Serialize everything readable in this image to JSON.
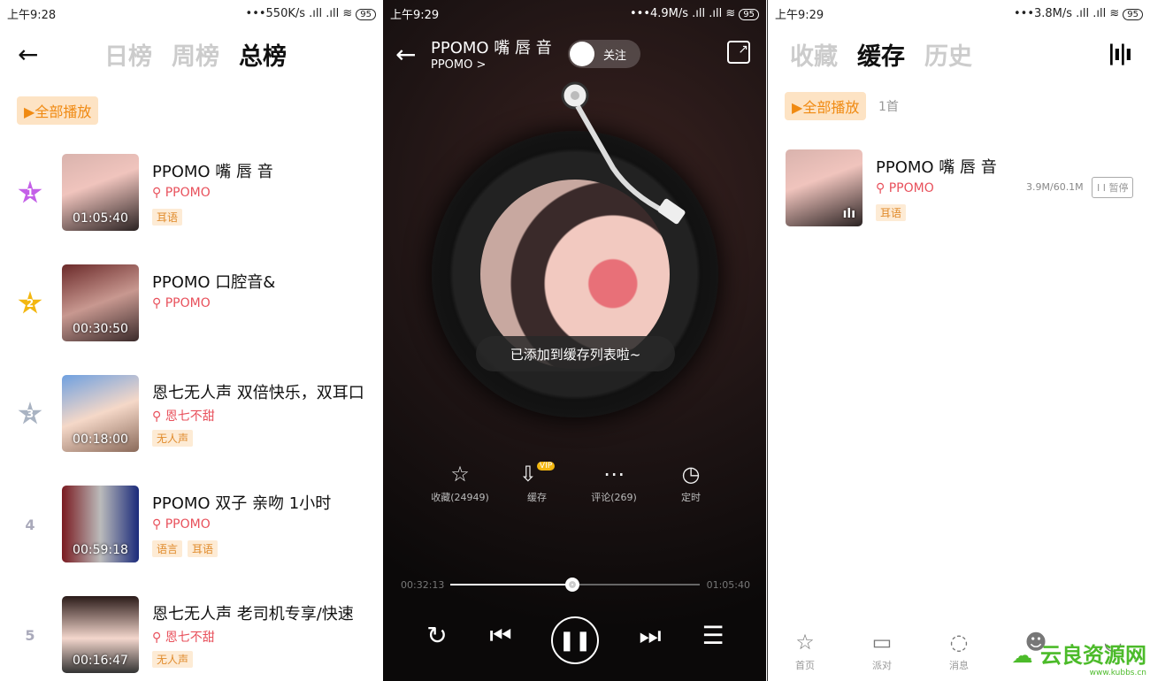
{
  "colors": {
    "accent": "#f08a12",
    "author": "#e8505b",
    "tag_bg": "#fdebd5"
  },
  "screen1": {
    "status": {
      "time": "上午9:28",
      "net": "•••550K/s .ıll .ıll ≋",
      "battery": "95"
    },
    "tabs": [
      "日榜",
      "周榜",
      "总榜"
    ],
    "active_tab": "总榜",
    "play_all": "全部播放",
    "items": [
      {
        "rank": "1",
        "title": "PPOMO 嘴 唇 音",
        "author": "PPOMO",
        "duration": "01:05:40",
        "tags": [
          "耳语"
        ],
        "rank_color": "#c460e8"
      },
      {
        "rank": "2",
        "title": "PPOMO 口腔音&",
        "author": "PPOMO",
        "duration": "00:30:50",
        "tags": [],
        "rank_color": "#f3b711"
      },
      {
        "rank": "3",
        "title": "恩七无人声 双倍快乐，双耳口",
        "author": "恩七不甜",
        "duration": "00:18:00",
        "tags": [
          "无人声"
        ],
        "rank_color": "#a9b3c2"
      },
      {
        "rank": "4",
        "title": "PPOMO 双子 亲吻 1小时",
        "author": "PPOMO",
        "duration": "00:59:18",
        "tags": [
          "语言",
          "耳语"
        ],
        "rank_color": ""
      },
      {
        "rank": "5",
        "title": "恩七无人声 老司机专享/快速",
        "author": "恩七不甜",
        "duration": "00:16:47",
        "tags": [
          "无人声"
        ],
        "rank_color": ""
      }
    ]
  },
  "screen2": {
    "status": {
      "time": "上午9:29",
      "net": "•••4.9M/s .ıll .ıll ≋",
      "battery": "95"
    },
    "title": "PPOMO 嘴 唇 音",
    "artist": "PPOMO >",
    "follow": "关注",
    "toast": "已添加到缓存列表啦~",
    "actions": [
      {
        "icon": "star-icon",
        "glyph": "☆",
        "label": "收藏(24949)"
      },
      {
        "icon": "cloud-download-icon",
        "glyph": "⇩",
        "label": "缓存",
        "badge": "VIP"
      },
      {
        "icon": "comment-icon",
        "glyph": "⋯",
        "label": "评论(269)"
      },
      {
        "icon": "timer-icon",
        "glyph": "◷",
        "label": "定时"
      }
    ],
    "elapsed": "00:32:13",
    "total": "01:05:40",
    "progress": 0.49
  },
  "screen3": {
    "status": {
      "time": "上午9:29",
      "net": "•••3.8M/s .ıll .ıll ≋",
      "battery": "95"
    },
    "tabs": [
      "收藏",
      "缓存",
      "历史"
    ],
    "active_tab": "缓存",
    "play_all": "全部播放",
    "count": "1首",
    "item": {
      "title": "PPOMO 嘴 唇 音",
      "author": "PPOMO",
      "tags": [
        "耳语"
      ],
      "size": "3.9M/60.1M",
      "pause": "I I 暂停"
    },
    "nav": [
      {
        "label": "首页",
        "glyph": "☆",
        "icon": "home-star-icon"
      },
      {
        "label": "派对",
        "glyph": "▭",
        "icon": "video-camera-icon"
      },
      {
        "label": "消息",
        "glyph": "◌",
        "icon": "message-icon"
      },
      {
        "label": "",
        "glyph": "☻",
        "icon": "headphone-mascot-icon"
      },
      {
        "label": "",
        "glyph": "◡",
        "icon": "profile-icon"
      }
    ],
    "watermark": "云良资源网",
    "watermark_url": "www.kubbs.cn"
  }
}
